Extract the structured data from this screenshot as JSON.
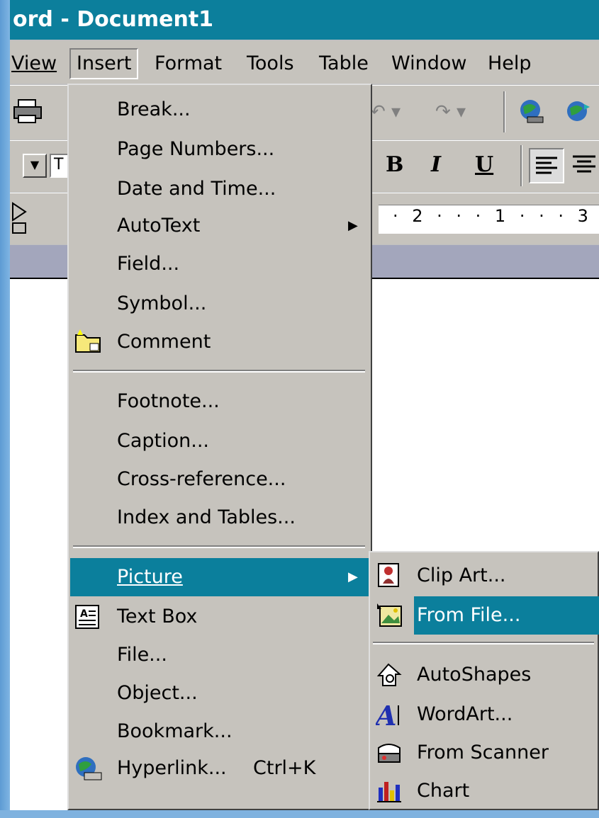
{
  "window": {
    "title": "ord - Document1"
  },
  "menubar": {
    "items": [
      "View",
      "Insert",
      "Format",
      "Tools",
      "Table",
      "Window",
      "Help"
    ],
    "open": "Insert"
  },
  "format_bar": {
    "font_field": "T",
    "bold": "B",
    "italic": "I",
    "underline": "U"
  },
  "ruler": {
    "text": "· 2 · · · 1 · · · 3"
  },
  "insert_menu": {
    "items": [
      {
        "label": "Break...",
        "u": "B"
      },
      {
        "label": "Page Numbers...",
        "u": "u"
      },
      {
        "label": "Date and Time...",
        "u": "T"
      },
      {
        "label": "AutoText",
        "u": "A",
        "submenu": true
      },
      {
        "label": "Field...",
        "u": "F"
      },
      {
        "label": "Symbol...",
        "u": "S"
      },
      {
        "label": "Comment",
        "u": "m",
        "icon": "comment-icon"
      },
      {
        "label": "Footnote...",
        "u": "n"
      },
      {
        "label": "Caption...",
        "u": "C"
      },
      {
        "label": "Cross-reference...",
        "u": "r"
      },
      {
        "label": "Index and Tables...",
        "u": "d"
      },
      {
        "label": "Picture",
        "u": "P",
        "submenu": true,
        "highlighted": true
      },
      {
        "label": "Text Box",
        "u": "x",
        "icon": "text-box-icon"
      },
      {
        "label": "File...",
        "u": "l"
      },
      {
        "label": "Object...",
        "u": "O"
      },
      {
        "label": "Bookmark...",
        "u": "k"
      },
      {
        "label": "Hyperlink...",
        "u": "i",
        "shortcut": "Ctrl+K",
        "icon": "hyperlink-icon"
      }
    ]
  },
  "picture_menu": {
    "items": [
      {
        "label": "Clip Art...",
        "icon": "clip-art-icon"
      },
      {
        "label": "From File...",
        "icon": "from-file-icon",
        "highlighted": true
      },
      {
        "label": "AutoShapes",
        "icon": "autoshapes-icon"
      },
      {
        "label": "WordArt...",
        "icon": "wordart-icon"
      },
      {
        "label": "From Scanner",
        "icon": "scanner-icon"
      },
      {
        "label": "Chart",
        "icon": "chart-icon"
      }
    ]
  },
  "colors": {
    "highlight": "#0b7f9c",
    "menu_bg": "#c6c3bd",
    "title_bg": "#0c7f9c"
  }
}
